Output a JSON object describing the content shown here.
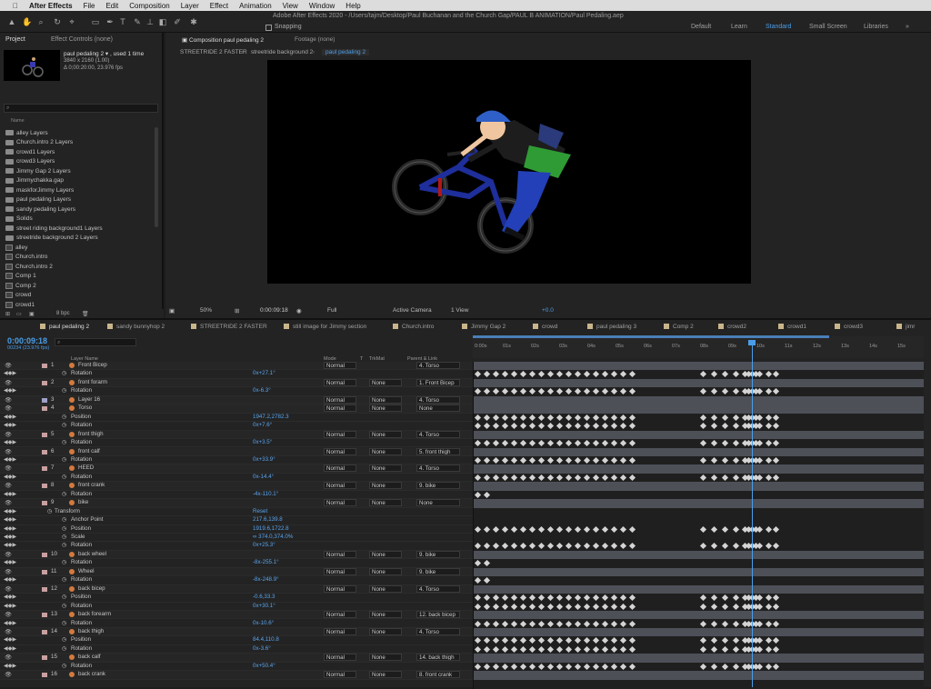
{
  "macbar": {
    "app": "After Effects",
    "menus": [
      "File",
      "Edit",
      "Composition",
      "Layer",
      "Effect",
      "Animation",
      "View",
      "Window",
      "Help"
    ]
  },
  "window_title": "Adobe After Effects 2020 - /Users/tajm/Desktop/Paul Buchanan and the Church Gap/PAUL B ANIMATION/Paul Pedaling.aep",
  "toolbar": {
    "snapping": "Snapping",
    "workspaces": [
      "Default",
      "Learn",
      "Standard",
      "Small Screen",
      "Libraries"
    ],
    "active_workspace": "Standard"
  },
  "project": {
    "tabs": [
      "Project",
      "Effect Controls (none)"
    ],
    "selected_name": "paul pedaling 2 ▾ , used 1 time",
    "info1": "3840 x 2160 (1.00)",
    "info2": "Δ 0;00:20:00, 23.976 fps",
    "col_name": "Name",
    "items": [
      {
        "type": "folder",
        "name": "alley Layers"
      },
      {
        "type": "folder",
        "name": "Church.intro 2 Layers"
      },
      {
        "type": "folder",
        "name": "crowd1 Layers"
      },
      {
        "type": "folder",
        "name": "crowd3 Layers"
      },
      {
        "type": "folder",
        "name": "Jimmy Gap 2 Layers"
      },
      {
        "type": "folder",
        "name": "Jimmychakka.gap"
      },
      {
        "type": "folder",
        "name": "maskforJimmy Layers"
      },
      {
        "type": "folder",
        "name": "paul pedaling Layers"
      },
      {
        "type": "folder",
        "name": "sandy pedaling Layers"
      },
      {
        "type": "folder",
        "name": "Solids"
      },
      {
        "type": "folder",
        "name": "street riding background1 Layers"
      },
      {
        "type": "folder",
        "name": "streetride background 2 Layers"
      },
      {
        "type": "comp",
        "name": "alley"
      },
      {
        "type": "comp",
        "name": "Church.intro"
      },
      {
        "type": "comp",
        "name": "Church.intro 2"
      },
      {
        "type": "comp",
        "name": "Comp 1"
      },
      {
        "type": "comp",
        "name": "Comp 2"
      },
      {
        "type": "comp",
        "name": "crowd"
      },
      {
        "type": "comp",
        "name": "crowd1"
      }
    ],
    "bpc": "8 bpc"
  },
  "viewer": {
    "tabs": [
      "Composition paul pedaling 2",
      "Footage (none)"
    ],
    "breadcrumbs": [
      "STREETRIDE 2 FASTER",
      "streetride background 2",
      "paul pedaling 2"
    ],
    "zoom": "50%",
    "timecode": "0:00:09:18",
    "resolution": "Full",
    "camera": "Active Camera",
    "views": "1 View",
    "exposure": "+0.0"
  },
  "timeline": {
    "tabs": [
      "paul pedaling 2",
      "sandy bunnyhop 2",
      "STREETRIDE 2 FASTER",
      "still image for Jimmy section",
      "Church.intro",
      "Jimmy Gap 2",
      "crowd",
      "paul pedaling 3",
      "Comp 2",
      "crowd2",
      "crowd1",
      "crowd3",
      "jimr"
    ],
    "tab_colors": [
      "#c9b58a",
      "#c9b58a",
      "#c9b58a",
      "#c9b58a",
      "#c9b58a",
      "#c9b58a",
      "#c9b58a",
      "#c9b58a",
      "#c9b58a",
      "#c9b58a",
      "#c9b58a",
      "#c9b58a",
      "#c9b58a"
    ],
    "timecode": "0:00:09:18",
    "fps": "00234 (23.976 fps)",
    "headers": {
      "layer_name": "Layer Name",
      "mode": "Mode",
      "t": "T",
      "trkmat": "TrkMat",
      "parent": "Parent & Link"
    },
    "ruler": [
      "0:00s",
      "01s",
      "02s",
      "03s",
      "04s",
      "05s",
      "06s",
      "07s",
      "08s",
      "09s",
      "10s",
      "11s",
      "12s",
      "13s",
      "14s",
      "15s"
    ],
    "rows": [
      {
        "kind": "layer",
        "num": "1",
        "name": "Front Bicep",
        "mode": "Normal",
        "trk": "",
        "parent": "4. Torso",
        "color": "#c9a0a0"
      },
      {
        "kind": "prop",
        "name": "Rotation",
        "value": "0x+27.1°"
      },
      {
        "kind": "layer",
        "num": "2",
        "name": "front forarm",
        "mode": "Normal",
        "trk": "None",
        "parent": "1. Front Bicep",
        "color": "#c9a0a0"
      },
      {
        "kind": "prop",
        "name": "Rotation",
        "value": "0x-6.3°"
      },
      {
        "kind": "layer",
        "num": "3",
        "name": "Layer 16",
        "mode": "Normal",
        "trk": "None",
        "parent": "4. Torso",
        "color": "#a0a0c9"
      },
      {
        "kind": "layer",
        "num": "4",
        "name": "Torso",
        "mode": "Normal",
        "trk": "None",
        "parent": "None",
        "color": "#c9a0a0"
      },
      {
        "kind": "prop",
        "name": "Position",
        "value": "1947.2,2782.3"
      },
      {
        "kind": "prop",
        "name": "Rotation",
        "value": "0x+7.6°"
      },
      {
        "kind": "layer",
        "num": "5",
        "name": "front thigh",
        "mode": "Normal",
        "trk": "None",
        "parent": "4. Torso",
        "color": "#c9a0a0"
      },
      {
        "kind": "prop",
        "name": "Rotation",
        "value": "0x+3.5°"
      },
      {
        "kind": "layer",
        "num": "6",
        "name": "front calf",
        "mode": "Normal",
        "trk": "None",
        "parent": "5. front thigh",
        "color": "#c9a0a0"
      },
      {
        "kind": "prop",
        "name": "Rotation",
        "value": "0x+33.9°"
      },
      {
        "kind": "layer",
        "num": "7",
        "name": "HEED",
        "mode": "Normal",
        "trk": "None",
        "parent": "4. Torso",
        "color": "#c9a0a0"
      },
      {
        "kind": "prop",
        "name": "Rotation",
        "value": "0x-14.4°"
      },
      {
        "kind": "layer",
        "num": "8",
        "name": "front crank",
        "mode": "Normal",
        "trk": "None",
        "parent": "9. bike",
        "color": "#c9a0a0"
      },
      {
        "kind": "prop",
        "name": "Rotation",
        "value": "-4x-110.1°"
      },
      {
        "kind": "layer",
        "num": "9",
        "name": "bike",
        "mode": "Normal",
        "trk": "None",
        "parent": "None",
        "color": "#c9a0a0"
      },
      {
        "kind": "group",
        "name": "Transform",
        "value": "Reset"
      },
      {
        "kind": "prop",
        "name": "Anchor Point",
        "value": "217.6,139.8"
      },
      {
        "kind": "prop",
        "name": "Position",
        "value": "1919.6,1722.8"
      },
      {
        "kind": "prop",
        "name": "Scale",
        "value": "∞ 374.0,374.0%"
      },
      {
        "kind": "prop",
        "name": "Rotation",
        "value": "0x+25.3°"
      },
      {
        "kind": "layer",
        "num": "10",
        "name": "back wheel",
        "mode": "Normal",
        "trk": "None",
        "parent": "9. bike",
        "color": "#c9a0a0"
      },
      {
        "kind": "prop",
        "name": "Rotation",
        "value": "-8x-255.1°"
      },
      {
        "kind": "layer",
        "num": "11",
        "name": "Wheel",
        "mode": "Normal",
        "trk": "None",
        "parent": "9. bike",
        "color": "#c9a0a0"
      },
      {
        "kind": "prop",
        "name": "Rotation",
        "value": "-8x-248.9°"
      },
      {
        "kind": "layer",
        "num": "12",
        "name": "back bicep",
        "mode": "Normal",
        "trk": "None",
        "parent": "4. Torso",
        "color": "#c9a0a0"
      },
      {
        "kind": "prop",
        "name": "Position",
        "value": "-0.6,33.3"
      },
      {
        "kind": "prop",
        "name": "Rotation",
        "value": "0x+30.1°"
      },
      {
        "kind": "layer",
        "num": "13",
        "name": "back forearm",
        "mode": "Normal",
        "trk": "None",
        "parent": "12. back bicep",
        "color": "#c9a0a0"
      },
      {
        "kind": "prop",
        "name": "Rotation",
        "value": "0x-10.6°"
      },
      {
        "kind": "layer",
        "num": "14",
        "name": "back thigh",
        "mode": "Normal",
        "trk": "None",
        "parent": "4. Torso",
        "color": "#c9a0a0"
      },
      {
        "kind": "prop",
        "name": "Position",
        "value": "84.4,110.8"
      },
      {
        "kind": "prop",
        "name": "Rotation",
        "value": "0x-3.6°"
      },
      {
        "kind": "layer",
        "num": "15",
        "name": "back calf",
        "mode": "Normal",
        "trk": "None",
        "parent": "14. back thigh",
        "color": "#c9a0a0"
      },
      {
        "kind": "prop",
        "name": "Rotation",
        "value": "0x+50.4°"
      },
      {
        "kind": "layer",
        "num": "16",
        "name": "back crank",
        "mode": "Normal",
        "trk": "None",
        "parent": "8. front crank",
        "color": "#c9a0a0"
      }
    ]
  }
}
